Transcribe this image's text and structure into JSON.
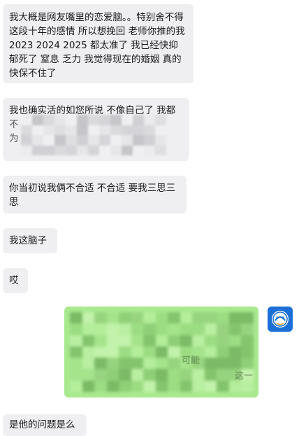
{
  "messages": {
    "m1": "我大概是网友嘴里的恋爱脑。。特别舍不得这段十年的感情 所以想挽回 老师你推的我2023 2024 2025 都太准了 我已经快抑郁死了 窒息 乏力  我觉得现在的婚姻 真的快保不住了",
    "m2_line1": "我也确实活的如您所说 不像自己了 我都",
    "m2_line2": "                       不",
    "m2_line3": "为                             庭",
    "m3": "你当初说我俩不合适  不合适  要我三思三思",
    "m4": "我这脑子",
    "m5": "哎",
    "m6": "是他的问题是么"
  },
  "sent": {
    "leak1": "可能",
    "leak2": "这一"
  },
  "avatar": {
    "icon": "blue-app-avatar-icon"
  },
  "colors": {
    "received_bubble": "#efeff2",
    "sent_bubble": "#a9e98f",
    "avatar_bg": "#1b6fd6"
  }
}
